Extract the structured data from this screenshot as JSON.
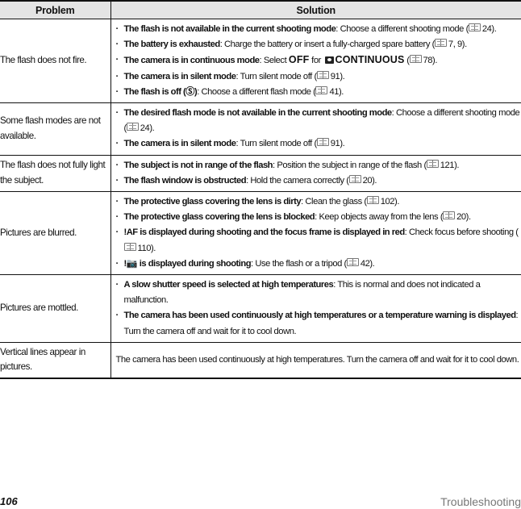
{
  "table": {
    "headers": {
      "problem": "Problem",
      "solution": "Solution"
    },
    "rows": [
      {
        "problem": "The flash does not fire.",
        "items": [
          {
            "bold": "The flash is not available in the current shooting mode",
            "text": ": Choose a different shooting mode (",
            "ref": "24",
            "tail": ")."
          },
          {
            "bold": "The battery is exhausted",
            "text": ": Charge the battery or insert a fully-charged spare battery (",
            "ref": "7, 9",
            "tail": ")."
          },
          {
            "bold": "The camera is in continuous mode",
            "text": ": Select ",
            "setting": "OFF",
            "for": " for ",
            "menu": "CONTINUOUS",
            "text2": " (",
            "ref": "78",
            "tail": ")."
          },
          {
            "bold": "The camera is in silent mode",
            "text": ": Turn silent mode off (",
            "ref": "91",
            "tail": ")."
          },
          {
            "bold": "The flash is off (Ⓢ)",
            "text": ": Choose a different flash mode (",
            "ref": "41",
            "tail": ")."
          }
        ]
      },
      {
        "problem": "Some flash modes are not available.",
        "items": [
          {
            "bold": "The desired flash mode is not available in the current shooting mode",
            "text": ": Choose a different shooting mode (",
            "ref": "24",
            "tail": ")."
          },
          {
            "bold": "The camera is in silent mode",
            "text": ": Turn silent mode off (",
            "ref": "91",
            "tail": ")."
          }
        ]
      },
      {
        "problem": "The flash does not fully light the subject.",
        "items": [
          {
            "bold": "The subject is not in range of the flash",
            "text": ": Position the subject in range of the flash (",
            "ref": "121",
            "tail": ")."
          },
          {
            "bold": "The flash window is obstructed",
            "text": ": Hold the camera correctly (",
            "ref": "20",
            "tail": ")."
          }
        ]
      },
      {
        "problem": "Pictures are blurred.",
        "items": [
          {
            "bold": "The protective glass covering the lens is dirty",
            "text": ": Clean the glass (",
            "ref": "102",
            "tail": ")."
          },
          {
            "bold": "The protective glass covering the lens is blocked",
            "text": ": Keep objects away from the lens (",
            "ref": "20",
            "tail": ")."
          },
          {
            "bold": "!AF is displayed during shooting and the focus frame is displayed in red",
            "text": ": Check focus before shooting (",
            "ref": "110",
            "tail": ")."
          },
          {
            "bold": "!📷 is displayed during shooting",
            "text": ": Use the flash or a tripod (",
            "ref": "42",
            "tail": ")."
          }
        ]
      },
      {
        "problem": "Pictures are mottled.",
        "items": [
          {
            "bold": "A slow shutter speed is selected at high temperatures",
            "text": ": This is normal and does not indicated a malfunction."
          },
          {
            "bold": "The camera has been used continuously at high temperatures or a temperature warning is displayed",
            "text": ": Turn the camera off and wait for it to cool down."
          }
        ]
      },
      {
        "problem": "Vertical lines appear in pictures.",
        "plain": "The camera has been used continuously at high temperatures.  Turn the camera off and wait for it to cool down."
      }
    ]
  },
  "footer": {
    "page_number": "106",
    "section": "Troubleshooting"
  },
  "bullet": "·"
}
